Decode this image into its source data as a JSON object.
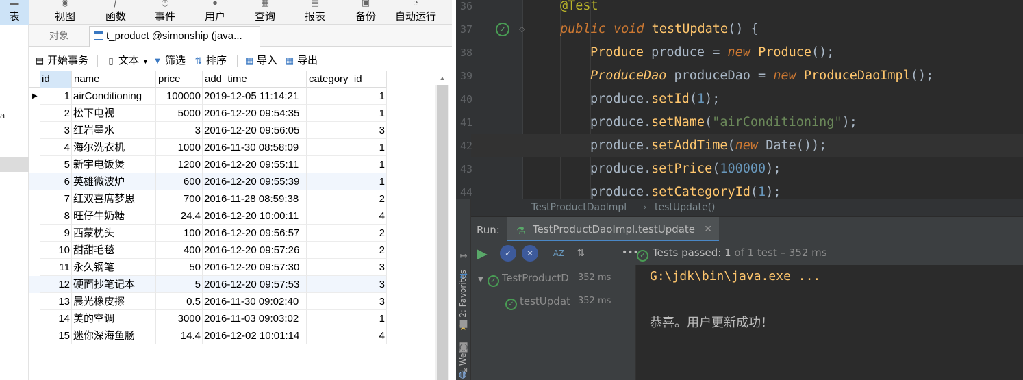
{
  "navicat": {
    "ribbon": [
      {
        "label": "表",
        "icon": "table-icon"
      },
      {
        "label": "视图",
        "icon": "view-icon"
      },
      {
        "label": "函数",
        "icon": "function-icon"
      },
      {
        "label": "事件",
        "icon": "event-icon"
      },
      {
        "label": "用户",
        "icon": "user-icon"
      },
      {
        "label": "查询",
        "icon": "query-icon"
      },
      {
        "label": "报表",
        "icon": "report-icon"
      },
      {
        "label": "备份",
        "icon": "backup-icon"
      },
      {
        "label": "自动运行",
        "icon": "auto-run-icon"
      }
    ],
    "side_mark": "a",
    "tabs": {
      "objects": "对象",
      "table": "t_product @simonship (java..."
    },
    "toolbar": {
      "begin_tx": "开始事务",
      "text": "文本",
      "filter": "筛选",
      "sort": "排序",
      "import": "导入",
      "export": "导出"
    },
    "columns": [
      "id",
      "name",
      "price",
      "add_time",
      "category_id"
    ],
    "rows": [
      [
        "1",
        "airConditioning",
        "100000",
        "2019-12-05 11:14:21",
        "1"
      ],
      [
        "2",
        "松下电视",
        "5000",
        "2016-12-20 09:54:35",
        "1"
      ],
      [
        "3",
        "红岩墨水",
        "3",
        "2016-12-20 09:56:05",
        "3"
      ],
      [
        "4",
        "海尔洗衣机",
        "1000",
        "2016-11-30 08:58:09",
        "1"
      ],
      [
        "5",
        "新宇电饭煲",
        "1200",
        "2016-12-20 09:55:11",
        "1"
      ],
      [
        "6",
        "英雄微波炉",
        "600",
        "2016-12-20 09:55:39",
        "1"
      ],
      [
        "7",
        "红双喜席梦思",
        "700",
        "2016-11-28 08:59:38",
        "2"
      ],
      [
        "8",
        "旺仔牛奶糖",
        "24.4",
        "2016-12-20 10:00:11",
        "4"
      ],
      [
        "9",
        "西蒙枕头",
        "100",
        "2016-12-20 09:56:57",
        "2"
      ],
      [
        "10",
        "甜甜毛毯",
        "400",
        "2016-12-20 09:57:26",
        "2"
      ],
      [
        "11",
        "永久钢笔",
        "50",
        "2016-12-20 09:57:30",
        "3"
      ],
      [
        "12",
        "硬面抄笔记本",
        "5",
        "2016-12-20 09:57:53",
        "3"
      ],
      [
        "13",
        "晨光橡皮擦",
        "0.5",
        "2016-11-30 09:02:40",
        "3"
      ],
      [
        "14",
        "美的空调",
        "3000",
        "2016-11-03 09:03:02",
        "1"
      ],
      [
        "15",
        "迷你深海鱼肠",
        "14.4",
        "2016-12-02 10:01:14",
        "4"
      ]
    ]
  },
  "ide": {
    "line_numbers": [
      "36",
      "37",
      "38",
      "39",
      "40",
      "41",
      "42",
      "43",
      "44"
    ],
    "code": {
      "l36": [
        "@Test"
      ],
      "l37": [
        "public",
        "void",
        "testUpdate",
        "() {"
      ],
      "l38": [
        "Produce",
        "produce",
        " = ",
        "new",
        "Produce",
        "();"
      ],
      "l39": [
        "ProduceDao",
        "produceDao",
        " = ",
        "new",
        "ProduceDaoImpl",
        "();"
      ],
      "l40": [
        "produce.",
        "setId",
        "(",
        "1",
        ");"
      ],
      "l41": [
        "produce.",
        "setName",
        "(",
        "\"airConditioning\"",
        ");"
      ],
      "l42": [
        "produce.",
        "setAddTime",
        "(",
        "new",
        "Date",
        "());"
      ],
      "l43": [
        "produce.",
        "setPrice",
        "(",
        "100000",
        ");"
      ],
      "l44": [
        "produce.",
        "setCategoryId",
        "(",
        "1",
        ");"
      ]
    },
    "breadcrumbs": [
      "TestProductDaoImpl",
      "testUpdate()"
    ],
    "run": {
      "label": "Run:",
      "tab": "TestProductDaoImpl.testUpdate",
      "status_prefix": "Tests passed:",
      "status_count": "1",
      "status_suffix": "of 1 test – 352 ms",
      "more": "•••"
    },
    "tree": [
      {
        "label": "TestProductD",
        "duration": "352 ms"
      },
      {
        "label": "testUpdat",
        "duration": "352 ms"
      }
    ],
    "side_tools": {
      "favorites": "2: Favorites",
      "web": "Web"
    },
    "console": [
      "G:\\jdk\\bin\\java.exe ...",
      "恭喜。用户更新成功！"
    ],
    "colors": {
      "accent": "#4a88c7",
      "pass": "#59a869",
      "bg": "#2b2b2b"
    }
  }
}
